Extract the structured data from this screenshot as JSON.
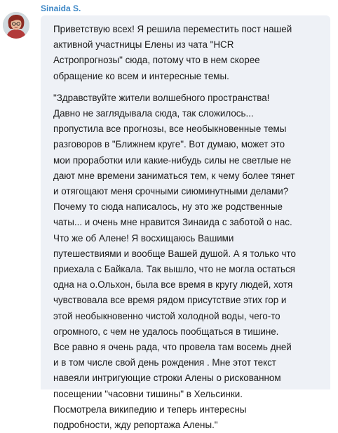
{
  "sender": {
    "name": "Sinaida S.",
    "avatar_icon": "user-avatar-photo",
    "name_color": "#3b86c6"
  },
  "message": {
    "paragraphs": [
      "Приветствую всех! Я решила переместить пост нашей\nактивной участницы Елены из чата \"HCR\nАстропрогнозы\" сюда, потому что в нем скорее\nобращение ко всем и интересные темы.",
      "\"Здравствуйте жители волшебного пространства!\nДавно не заглядывала сюда, так сложилось...\nпропустила все прогнозы, все необыкновенные темы\nразговоров в \"Ближнем круге\". Вот думаю, может это\nмои проработки или какие-нибудь силы не светлые не\nдают мне времени заниматься тем, к чему более тянет\nи отягощают меня срочными сиюминутными делами?\nПочему то сюда написалось, ну это же родственные\nчаты... и очень мне нравится Зинаида с  заботой о нас.\nЧто же об Алене! Я восхищаюсь Вашими\nпутешествиями и вообще Вашей душой. А я только что\nприехала с Байкала. Так вышло, что не могла остаться\nодна на о.Ольхон, была все время в кругу людей, хотя\nчувствовала все время рядом присутствие этих гор и\nэтой необыкновенно чистой холодной воды, чего-то\nогромного, с чем не удалось пообщаться в тишине.\nВсе равно я очень рада, что провела там восемь дней\nи в том числе свой день рождения  . Мне этот текст\nнавеяли интригующие строки Алены о рискованном\nпосещении  \"часовни тишины\" в Хельсинки.\nПосмотрела википедию и теперь интересны\nподробности, жду репортажа Алены.\""
    ],
    "bubble_color": "#eef1f6"
  }
}
